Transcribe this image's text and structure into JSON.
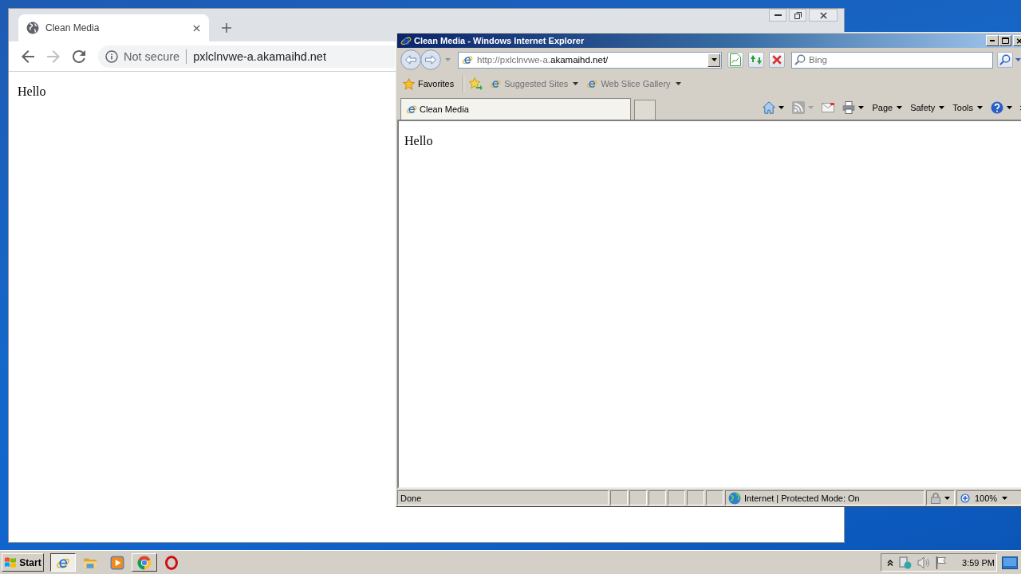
{
  "chrome_window": {
    "tabs": [
      {
        "title": "Clean Media",
        "selected": true
      }
    ],
    "navigation": {
      "back": {
        "disabled": false
      },
      "forward": {
        "disabled": true
      }
    },
    "omnibox": {
      "security": "Not secure",
      "url": "pxlclnvwe-a.akamaihd.net"
    },
    "page": {
      "text": "Hello"
    }
  },
  "ie_window": {
    "title": "Clean Media - Windows Internet Explorer",
    "address": "http://pxlclnvwe-a.**akamaihd.net/**",
    "search": {
      "placeholder": "Bing"
    },
    "favorites_bar": {
      "favorites": "Favorites",
      "links": [
        {
          "label": "Suggested Sites"
        },
        {
          "label": "Web Slice Gallery"
        }
      ]
    },
    "tabs": [
      {
        "title": "Clean Media",
        "selected": true
      }
    ],
    "command_bar": {
      "feeds": {
        "disabled": true
      },
      "menus": [
        {
          "label": "Page"
        },
        {
          "label": "Safety"
        },
        {
          "label": "Tools"
        }
      ]
    },
    "page": {
      "text": "Hello"
    },
    "status_bar": {
      "status": "Done",
      "zone": "Internet | Protected Mode: On",
      "zoom": "100%"
    }
  },
  "taskbar": {
    "start": "Start",
    "items": [
      {
        "kind": "ie",
        "running": true,
        "selected": true
      },
      {
        "kind": "folder",
        "running": false,
        "selected": false
      },
      {
        "kind": "media",
        "running": false,
        "selected": false
      },
      {
        "kind": "chrome",
        "running": true,
        "selected": false
      },
      {
        "kind": "opera",
        "running": false,
        "selected": false
      }
    ],
    "clock": "3:59 PM"
  }
}
